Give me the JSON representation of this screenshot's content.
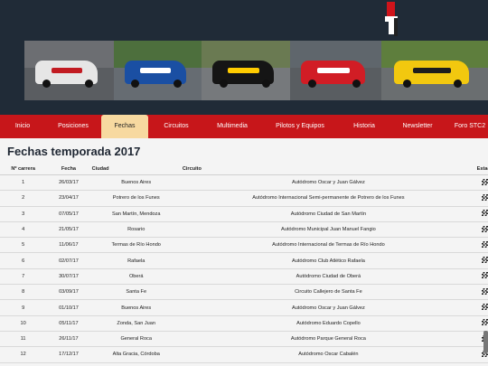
{
  "nav": [
    {
      "label": "Inicio",
      "active": false
    },
    {
      "label": "Posiciones",
      "active": false
    },
    {
      "label": "Fechas",
      "active": true
    },
    {
      "label": "Circuitos",
      "active": false
    },
    {
      "label": "Multimedia",
      "active": false
    },
    {
      "label": "Pilotos y Equipos",
      "active": false
    },
    {
      "label": "Historia",
      "active": false
    },
    {
      "label": "Newsletter",
      "active": false
    },
    {
      "label": "Foro STC2",
      "active": false
    }
  ],
  "page": {
    "title": "Fechas temporada 2017"
  },
  "table": {
    "headers": [
      "Nº carrera",
      "Fecha",
      "Ciudad",
      "Circuito",
      "Estado"
    ],
    "rows": [
      [
        "1",
        "26/03/17",
        "Buenos Aires",
        "Autódromo Oscar y Juan Gálvez"
      ],
      [
        "2",
        "23/04/17",
        "Potrero de los Funes",
        "Autódromo Internacional Semi-permanente de Potrero de los Funes"
      ],
      [
        "3",
        "07/05/17",
        "San Martín, Mendoza",
        "Autódromo Ciudad de San Martín"
      ],
      [
        "4",
        "21/05/17",
        "Rosario",
        "Autódromo Municipal Juan Manuel Fangio"
      ],
      [
        "5",
        "11/06/17",
        "Termas de Río Hondo",
        "Autódromo Internacional de Termas de Río Hondo"
      ],
      [
        "6",
        "02/07/17",
        "Rafaela",
        "Autódromo Club Atlético Rafaela"
      ],
      [
        "7",
        "30/07/17",
        "Oberá",
        "Autódromo Ciudad de Oberá"
      ],
      [
        "8",
        "03/09/17",
        "Santa Fe",
        "Circuito Callejero de Santa Fe"
      ],
      [
        "9",
        "01/10/17",
        "Buenos Aires",
        "Autódromo Oscar y Juan Gálvez"
      ],
      [
        "10",
        "05/11/17",
        "Zonda, San Juan",
        "Autódromo Eduardo Copello"
      ],
      [
        "11",
        "26/11/17",
        "General Roca",
        "Autódromo Parque General Roca"
      ],
      [
        "12",
        "17/12/17",
        "Alta Gracia, Córdoba",
        "Autódromo Oscar Cabalén"
      ]
    ]
  },
  "colors": {
    "nav_bg": "#c7161a",
    "header_bg": "#202b37",
    "active_tab": "#f7d9a0",
    "logo_red": "#d0141b"
  }
}
